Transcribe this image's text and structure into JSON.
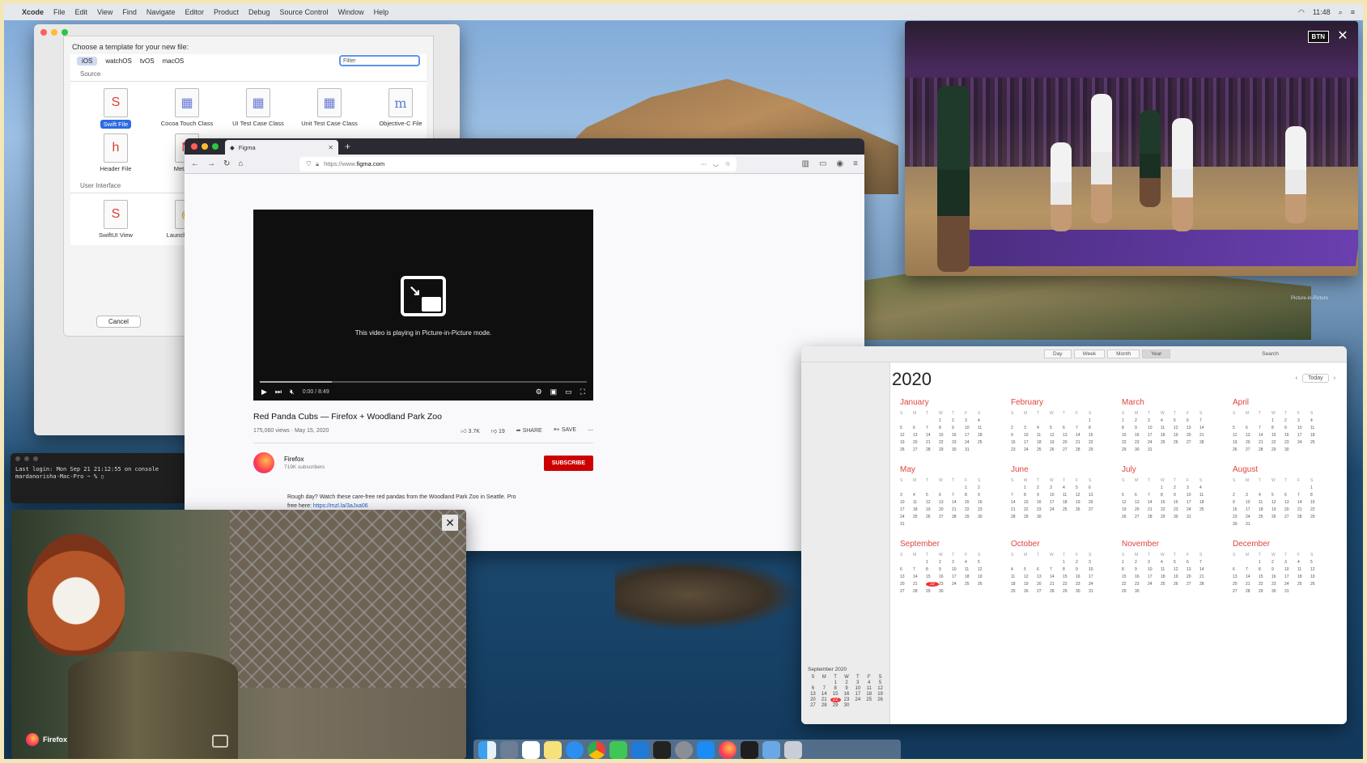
{
  "menubar": {
    "apple": "",
    "app": "Xcode",
    "items": [
      "File",
      "Edit",
      "View",
      "Find",
      "Navigate",
      "Editor",
      "Product",
      "Debug",
      "Source Control",
      "Window",
      "Help"
    ],
    "time": "11:48"
  },
  "xcode": {
    "heading": "Choose a template for your new file:",
    "tabs": [
      "iOS",
      "watchOS",
      "tvOS",
      "macOS"
    ],
    "filter_placeholder": "Filter",
    "section_source": "Source",
    "section_ui": "User Interface",
    "templates": [
      {
        "label": "Swift File",
        "glyph": "S"
      },
      {
        "label": "Cocoa Touch Class",
        "glyph": "▦"
      },
      {
        "label": "UI Test Case Class",
        "glyph": "▦"
      },
      {
        "label": "Unit Test Case Class",
        "glyph": "▦"
      },
      {
        "label": "Objective-C File",
        "glyph": "m"
      },
      {
        "label": "Header File",
        "glyph": "h"
      },
      {
        "label": "Metal File",
        "glyph": "M"
      }
    ],
    "ui_templates": [
      {
        "label": "SwiftUI View",
        "glyph": "S"
      },
      {
        "label": "Launch Screen",
        "glyph": "◉"
      }
    ],
    "cancel": "Cancel"
  },
  "terminal": {
    "line1": "Last login: Mon Sep 21 21:12:55 on console",
    "line2": "mardanorisha-Mac-Pro ~ % "
  },
  "firefox": {
    "tab_title": "Figma",
    "url_prefix": "https://www.",
    "url_host": "figma.com",
    "pip_message": "This video is playing in Picture-in-Picture mode.",
    "time": "0:00 / 8:49",
    "video_title": "Red Panda Cubs — Firefox + Woodland Park Zoo",
    "views": "175,060 views · May 15, 2020",
    "likes": "3.7K",
    "dislikes": "19",
    "share": "SHARE",
    "save": "SAVE",
    "channel": "Firefox",
    "subscribers": "719K subscribers",
    "subscribe": "SUBSCRIBE",
    "description": "Rough day? Watch these care-free red pandas from the Woodland Park Zoo in Seattle. Pro",
    "description_link_prefix": "free here: ",
    "description_link": "https://mzl.la/3aJxa06"
  },
  "pip_game": {
    "network": "BTN",
    "close": "✕",
    "sub": "Picture-in-Picture"
  },
  "pip_panda": {
    "brand": "Firefox",
    "close": "✕"
  },
  "calendar": {
    "year": "2020",
    "today": "Today",
    "views": [
      "Day",
      "Week",
      "Month",
      "Year"
    ],
    "search_placeholder": "Search",
    "mini_header": "September 2020",
    "months": [
      "January",
      "February",
      "March",
      "April",
      "May",
      "June",
      "July",
      "August",
      "September",
      "October",
      "November",
      "December"
    ],
    "dow": [
      "S",
      "M",
      "T",
      "W",
      "T",
      "F",
      "S"
    ]
  },
  "colors": {
    "accent_red": "#e0443e",
    "subscribe_red": "#cc0000",
    "link_blue": "#1a5dc9",
    "xcode_selection": "#2d6ae3"
  }
}
